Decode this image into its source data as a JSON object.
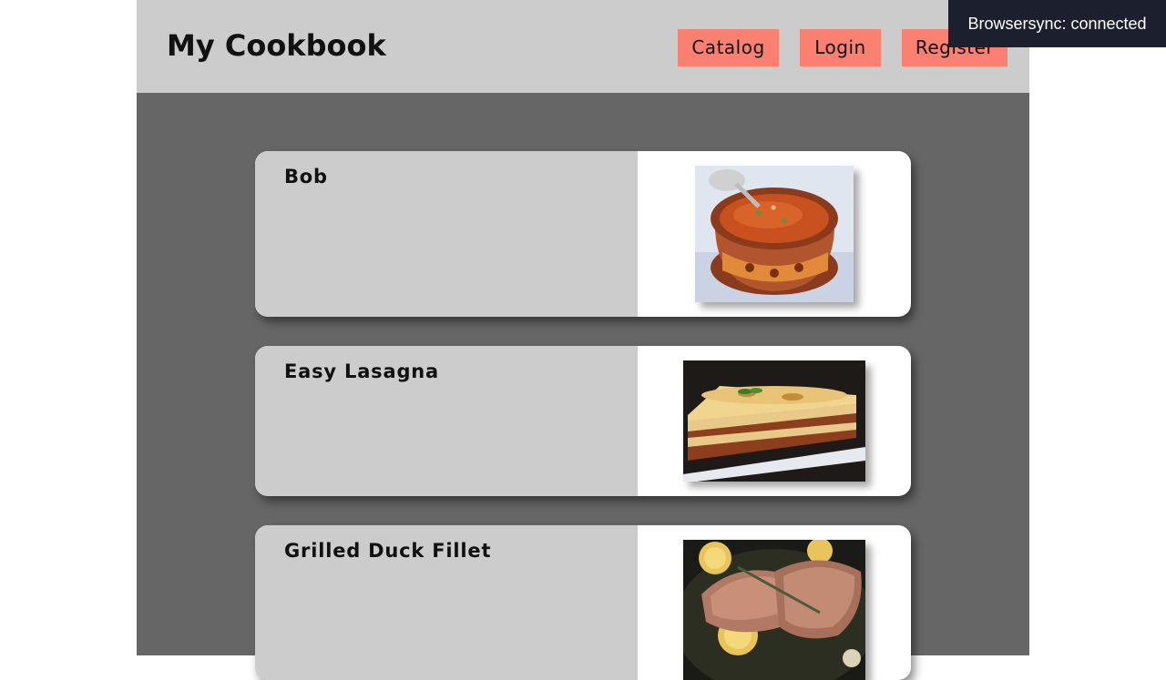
{
  "header": {
    "title": "My Cookbook",
    "nav": {
      "catalog": "Catalog",
      "login": "Login",
      "register": "Register"
    }
  },
  "recipes": [
    {
      "name": "Bob",
      "image": "soup-pot-image"
    },
    {
      "name": "Easy Lasagna",
      "image": "lasagna-image"
    },
    {
      "name": "Grilled Duck Fillet",
      "image": "duck-fillet-image"
    }
  ],
  "toast": {
    "text": "Browsersync: connected"
  },
  "colors": {
    "header_bg": "#cccccc",
    "nav_button": "#fa8072",
    "main_bg": "#666666",
    "card_info_bg": "#cccccc",
    "toast_bg": "#1b1f2e"
  }
}
